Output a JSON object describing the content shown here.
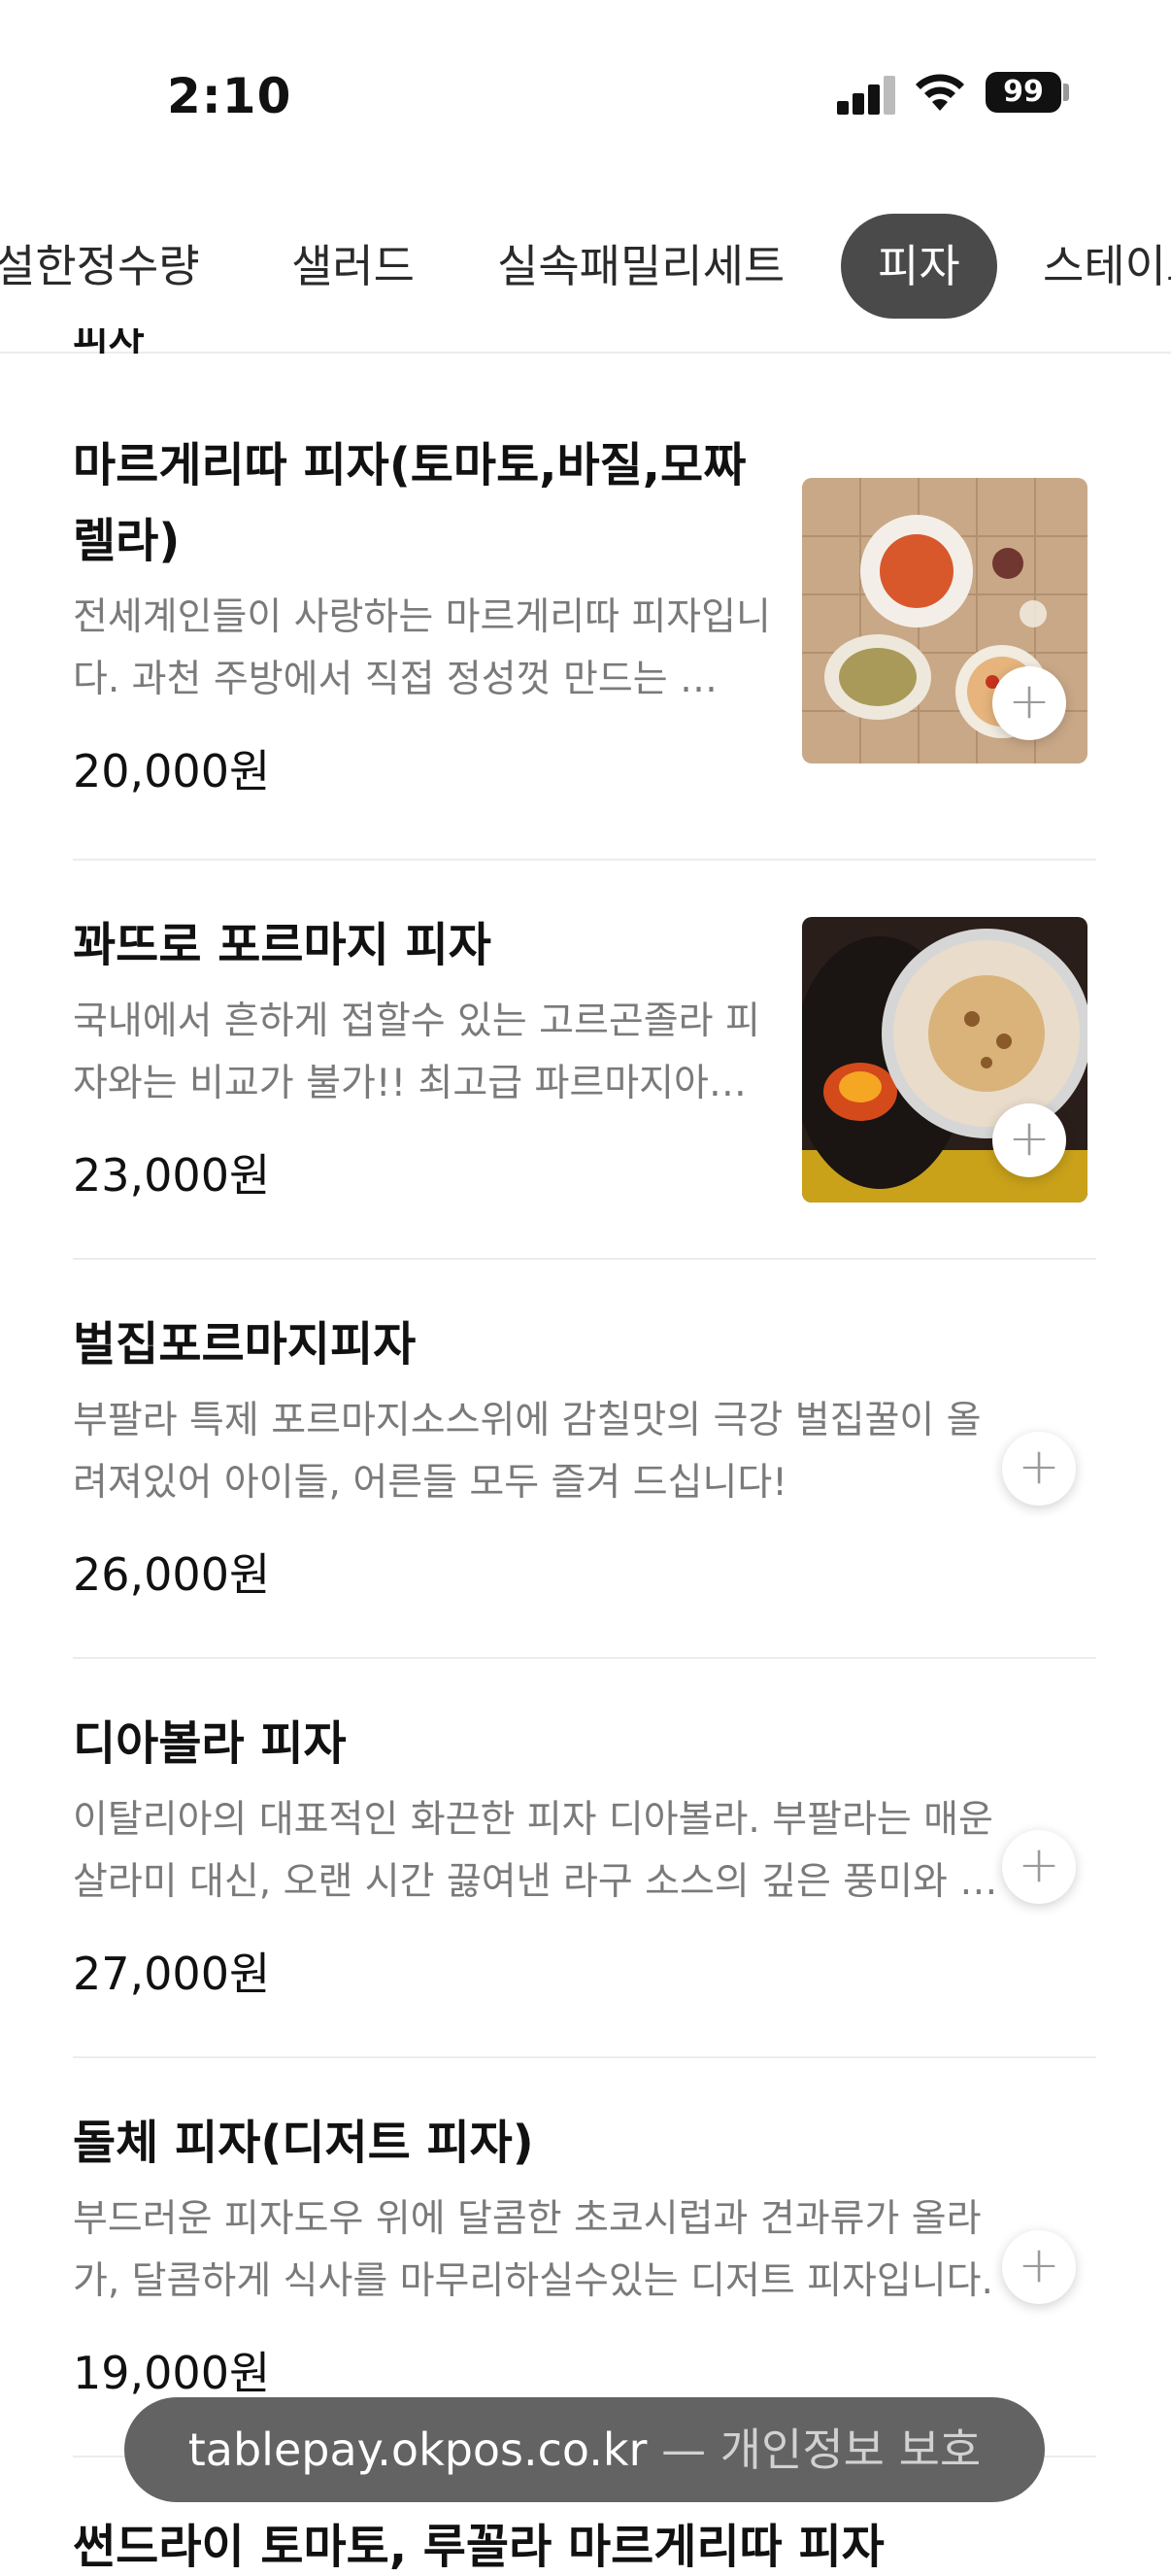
{
  "status_bar": {
    "time": "2:10",
    "battery": "99"
  },
  "tabs": [
    {
      "label": "설한정수량",
      "active": false
    },
    {
      "label": "샐러드",
      "active": false
    },
    {
      "label": "실속패밀리세트",
      "active": false
    },
    {
      "label": "피자",
      "active": true
    },
    {
      "label": "스테이크"
    }
  ],
  "section_heading": "피자",
  "items": [
    {
      "title": "마르게리따 피자(토마토,바질,모짜렐라)",
      "desc": "전세계인들이 사랑하는 마르게리따 피자입니다. 과천 주방에서 직접 정성껏 만드는 …",
      "price": "20,000원"
    },
    {
      "title": "꽈뜨로 포르마지 피자",
      "desc": "국내에서 흔하게 접할수 있는 고르곤졸라 피자와는 비교가 불가!! 최고급 파르마지아…",
      "price": "23,000원"
    },
    {
      "title": "벌집포르마지피자",
      "desc": "부팔라 특제 포르마지소스위에 감칠맛의 극강 벌집꿀이 올려져있어 아이들, 어른들 모두 즐겨 드십니다!",
      "price": "26,000원"
    },
    {
      "title": "디아볼라 피자",
      "desc": "이탈리아의 대표적인 화끈한 피자 디아볼라. 부팔라는 매운 살라미 대신, 오랜 시간 끓여낸 라구 소스의 깊은 풍미와 …",
      "price": "27,000원"
    },
    {
      "title": "돌체 피자(디저트 피자)",
      "desc": "부드러운 피자도우 위에 달콤한 초코시럽과 견과류가 올라가, 달콤하게 식사를 마무리하실수있는 디저트 피자입니다.",
      "price": "19,000원"
    }
  ],
  "next_item_title": "썬드라이 토마토, 루꼴라 마르게리따 피자",
  "url_pill": {
    "domain": "tablepay.okpos.co.kr",
    "label": " — 개인정보 보호"
  }
}
